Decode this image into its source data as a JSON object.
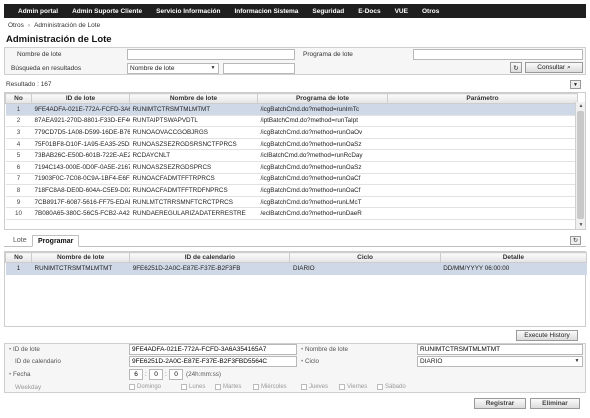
{
  "menu": [
    "Admin portal",
    "Admin Suporte Cliente",
    "Servicio Información",
    "Informacion Sistema",
    "Seguridad",
    "E-Docs",
    "VUE",
    "Otros"
  ],
  "breadcrumb": [
    "Otros",
    "Administración de Lote"
  ],
  "page_title": "Administración de Lote",
  "filters": {
    "name_label": "Nombre de lote",
    "program_label": "Programa de lote",
    "search_label": "Búsqueda en resultados",
    "search_select": "Nombre de lote",
    "consult_label": "Consultar"
  },
  "result_label": "Resultado : 167",
  "grid": {
    "headers": [
      "No",
      "ID de lote",
      "Nombre de lote",
      "Programa de lote",
      "Parámetro"
    ],
    "rows": [
      [
        "1",
        "9FE4ADFA-021E-772A-FCFD-3A6A3!",
        "RUNIMTCTRSMTMLMTMT",
        "/icgBatchCmd.do?method=runImTc",
        ""
      ],
      [
        "2",
        "87AEA921-270D-8801-F33D-EF4C8",
        "RUNTAIPTSWAPVDTL",
        "/iptBatchCmd.do?method=runTaIpt",
        ""
      ],
      [
        "3",
        "779CD7D5-1A08-D599-16DE-B767€",
        "RUNOAOVACCGOBJRGS",
        "/icgBatchCmd.do?method=runOaOv",
        ""
      ],
      [
        "4",
        "75F01BF8-D10F-1A95-EA35-25DF0C",
        "RUNOASZSEZRGDSRSNCTFPRCS",
        "/icgBatchCmd.do?method=runOaSz",
        ""
      ],
      [
        "5",
        "73BAB26C-E50D-601B-722E-AE2D1",
        "RCDAYCNLT",
        "/iclBatchCmd.do?method=runRcDay",
        ""
      ],
      [
        "6",
        "7194C143-000E-0D0F-0A5E-216748",
        "RUNOASZSEZRGDSPRCS",
        "/icgBatchCmd.do?method=runOaSz",
        ""
      ],
      [
        "7",
        "71903F0C-7C08-0C9A-1BF4-E6F167",
        "RUNOACFADMTFFTRPRCS",
        "/icgBatchCmd.do?method=runOaCf",
        ""
      ],
      [
        "8",
        "718FC8A8-DE0D-604A-C5E9-D0215",
        "RUNOACFADMTFFTRDFNPRCS",
        "/icgBatchCmd.do?method=runOaCf",
        ""
      ],
      [
        "9",
        "7CB8917F-6087-5616-FF75-EDAF6E",
        "RUNLMTCTRRSMNFTCRCTPRCS",
        "/icgBatchCmd.do?method=runLMcT",
        ""
      ],
      [
        "10",
        "7B080A65-380C-56C5-FCB2-A4242",
        "RUNDAEREGULARIZADATERRESTRE",
        "/eclBatchCmd.do?method=runDaeR",
        ""
      ]
    ]
  },
  "tabs": [
    "Lote",
    "Programar"
  ],
  "schedule_grid": {
    "headers": [
      "No",
      "Nombre de lote",
      "ID de calendario",
      "Ciclo",
      "Detalle"
    ],
    "rows": [
      [
        "1",
        "RUNIMTCTRSMTMLMTMT",
        "9FE6251D-2A0C-E87E-F37E-B2F3FB",
        "DIARIO",
        "DD/MM/YYYY 06:00:00"
      ]
    ]
  },
  "execute_history_label": "Execute History",
  "form": {
    "lote_id_label": "ID de lote",
    "lote_id_value": "9FE4ADFA-021E-772A-FCFD-3A6A354165A7",
    "lote_name_label": "Nombre de lote",
    "lote_name_value": "RUNIMTCTRSMTMLMTMT",
    "calendar_id_label": "ID de calendario",
    "calendar_id_value": "9FE6251D-2A0C-E87E-F37E-B2F3FBD5564C",
    "cycle_label": "Ciclo",
    "cycle_value": "DIARIO",
    "date_label": "Fecha",
    "hour": "6",
    "minute": "0",
    "second": "0",
    "time_hint": "(24h:mm:ss)",
    "weekday_label": "Weekday",
    "weekdays": [
      "Domingo",
      "Lunes",
      "Martes",
      "Miércoles",
      "Jueves",
      "Viernes",
      "Sábado"
    ]
  },
  "buttons": {
    "register": "Registrar",
    "delete": "Eliminar"
  }
}
